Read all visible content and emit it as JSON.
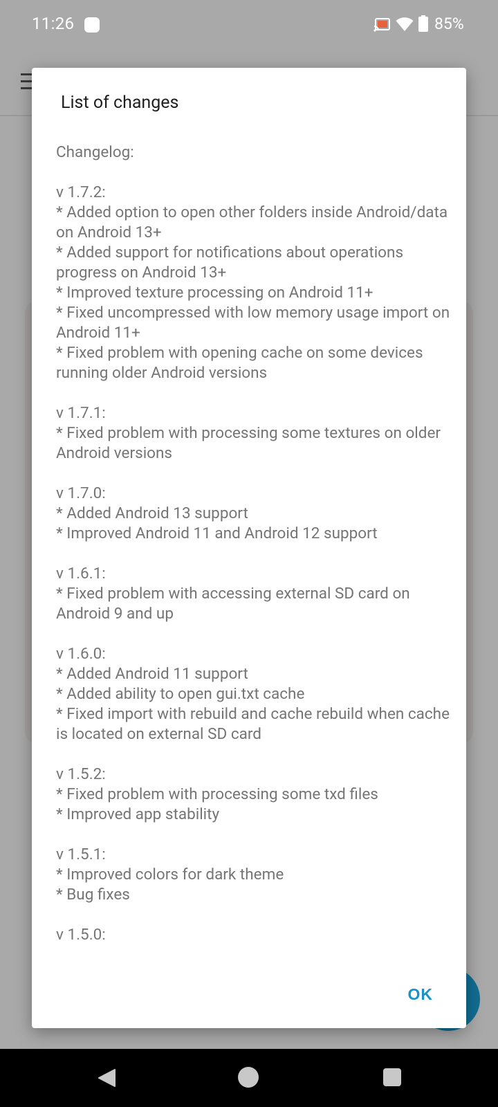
{
  "status_bar": {
    "time": "11:26",
    "battery": "85%",
    "icons": [
      "note-icon",
      "cast-icon",
      "wifi-icon",
      "battery-icon"
    ]
  },
  "dialog": {
    "title": "List of changes",
    "header": "Changelog:",
    "releases": [
      {
        "version": "v 1.7.2:",
        "changes": [
          "* Added option to open other folders inside Android/data on Android 13+",
          "* Added support for notifications about operations progress on Android 13+",
          "* Improved texture processing on Android 11+",
          "* Fixed uncompressed with low memory usage import on Android 11+",
          "* Fixed problem with opening cache on some devices running older Android versions"
        ]
      },
      {
        "version": "v 1.7.1:",
        "changes": [
          "* Fixed problem with processing some textures on older Android versions"
        ]
      },
      {
        "version": "v 1.7.0:",
        "changes": [
          "* Added Android 13 support",
          "* Improved Android 11 and Android 12 support"
        ]
      },
      {
        "version": "v 1.6.1:",
        "changes": [
          "* Fixed problem with accessing external SD card on Android 9 and up"
        ]
      },
      {
        "version": "v 1.6.0:",
        "changes": [
          "* Added Android 11 support",
          "* Added ability to open gui.txt cache",
          "* Fixed import with rebuild and cache rebuild when cache is located on external SD card"
        ]
      },
      {
        "version": "v 1.5.2:",
        "changes": [
          "* Fixed problem with processing some txd files",
          "* Improved app stability"
        ]
      },
      {
        "version": "v 1.5.1:",
        "changes": [
          "* Improved colors for dark theme",
          "* Bug fixes"
        ]
      },
      {
        "version": "v 1.5.0:",
        "changes": []
      }
    ],
    "ok_label": "OK"
  },
  "colors": {
    "accent": "#1793c7",
    "body_text": "#757575",
    "scrim": "#a9a9a9",
    "fab": "#106e93"
  },
  "nav_bar": {
    "icons": [
      "back-icon",
      "home-icon",
      "recents-icon"
    ]
  }
}
